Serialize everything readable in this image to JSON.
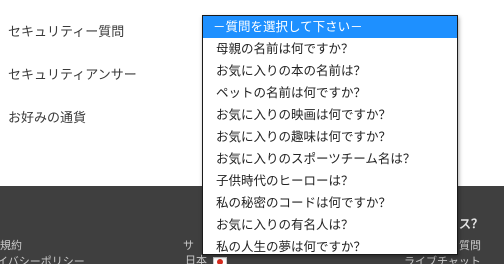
{
  "form": {
    "labels": [
      "セキュリティー質問",
      "セキュリティアンサー",
      "お好みの通貨"
    ]
  },
  "security_question_select": {
    "options": [
      "－質問を選択して下さい－",
      "母親の名前は何ですか？",
      "お気に入りの本の名前は？",
      "ペットの名前は何ですか？",
      "お気に入りの映画は何ですか？",
      "お気に入りの趣味は何ですか？",
      "お気に入りのスポーツチーム名は？",
      "子供時代のヒーローは？",
      "私の秘密のコードは何ですか？",
      "お気に入りの有名人は？",
      "私の人生の夢は何ですか？"
    ],
    "selected_index": 0
  },
  "footer": {
    "left_links": [
      "規約",
      "イバシーポリシー"
    ],
    "middle_link": "サ",
    "language": "日本",
    "right_heading": "ス？",
    "right_links": [
      "質問",
      "ライブチャット"
    ]
  },
  "colors": {
    "highlight": "#1e90ff",
    "footer_bg": "#3f3f3f"
  }
}
